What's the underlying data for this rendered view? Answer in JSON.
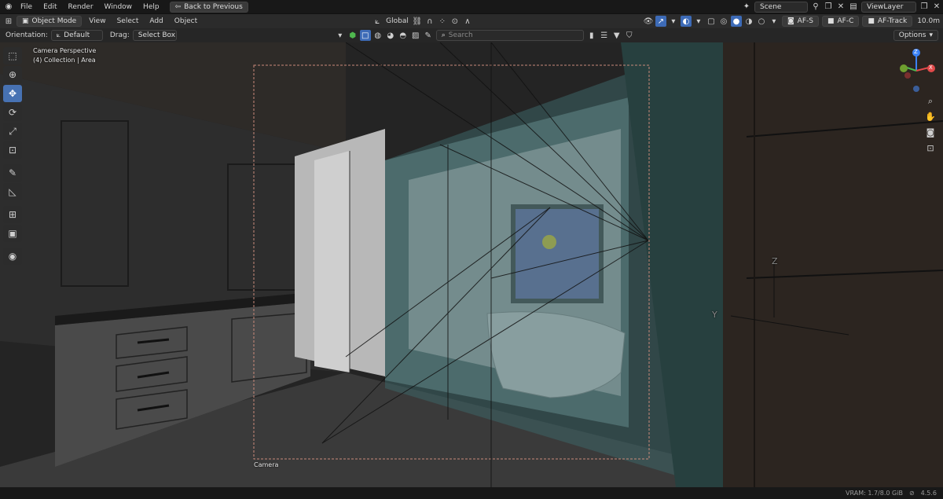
{
  "menu": {
    "items": [
      "File",
      "Edit",
      "Render",
      "Window",
      "Help"
    ],
    "back_label": "Back to Previous"
  },
  "topright": {
    "scene_label": "Scene",
    "viewlayer_label": "ViewLayer"
  },
  "header": {
    "mode_label": "Object Mode",
    "menus": [
      "View",
      "Select",
      "Add",
      "Object"
    ],
    "transform_label": "Global",
    "render_buttons": [
      "AF-S",
      "AF-C",
      "AF-Track"
    ],
    "clip_distance": "10.0m"
  },
  "tool_header": {
    "orientation_label": "Orientation:",
    "orientation_value": "Default",
    "drag_label": "Drag:",
    "drag_value": "Select Box",
    "search_placeholder": "Search",
    "options_label": "Options"
  },
  "viewport": {
    "camera_perspective": "Camera Perspective",
    "collection_info": "(4) Collection | Area",
    "camera_label": "Camera",
    "axis_z": "Z",
    "axis_y": "Y",
    "gizmo_z": "Z",
    "gizmo_x": "X"
  },
  "status": {
    "vram": "VRAM: 1.7/8.0 GiB",
    "version": "4.5.6"
  },
  "colors": {
    "accent": "#4772b3",
    "sky_window": "#7b7fc0",
    "sun": "#f1e13a",
    "glass": "#3c6566"
  }
}
